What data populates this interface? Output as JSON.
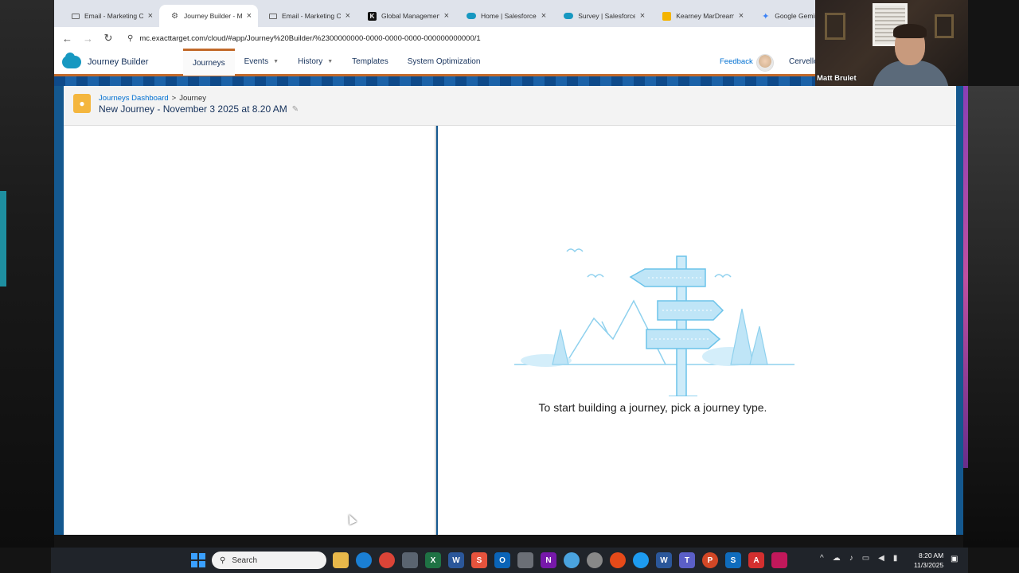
{
  "browser": {
    "tabs": [
      {
        "title": "Email - Marketing Clo",
        "icon": "mail-icon",
        "active": false
      },
      {
        "title": "Journey Builder - Mar",
        "icon": "gear-icon",
        "active": true
      },
      {
        "title": "Email - Marketing Clo",
        "icon": "mail-icon",
        "active": false
      },
      {
        "title": "Global Management",
        "icon": "k-logo-icon",
        "active": false
      },
      {
        "title": "Home | Salesforce",
        "icon": "salesforce-cloud-icon",
        "active": false
      },
      {
        "title": "Survey | Salesforce",
        "icon": "salesforce-cloud-icon",
        "active": false
      },
      {
        "title": "Kearney MarDreamin",
        "icon": "slides-icon",
        "active": false
      },
      {
        "title": "Google Gemini",
        "icon": "gemini-icon",
        "active": false
      }
    ],
    "close_glyph": "×",
    "url": "mc.exacttarget.com/cloud/#app/Journey%20Builder/%2300000000-0000-0000-0000-000000000000/1"
  },
  "app": {
    "name": "Journey Builder",
    "nav": [
      {
        "label": "Journeys",
        "active": true,
        "dropdown": false
      },
      {
        "label": "Events",
        "active": false,
        "dropdown": true
      },
      {
        "label": "History",
        "active": false,
        "dropdown": true
      },
      {
        "label": "Templates",
        "active": false,
        "dropdown": false
      },
      {
        "label": "System Optimization",
        "active": false,
        "dropdown": false
      }
    ],
    "feedback": "Feedback",
    "org": "Cervello"
  },
  "journey": {
    "breadcrumb_parent": "Journeys Dashboard",
    "breadcrumb_sep": ">",
    "breadcrumb_current": "Journey",
    "title": "New Journey - November 3 2025 at 8.20 AM",
    "empty_message": "To start building a journey, pick a journey type."
  },
  "webcam": {
    "name": "Matt Brulet"
  },
  "taskbar": {
    "search_label": "Search",
    "time": "8:20 AM",
    "date": "11/3/2025"
  },
  "colors": {
    "salesforce_blue": "#1798c1",
    "link_blue": "#0070d2",
    "accent_orange": "#c26a2a",
    "journey_icon": "#f4b63e"
  }
}
